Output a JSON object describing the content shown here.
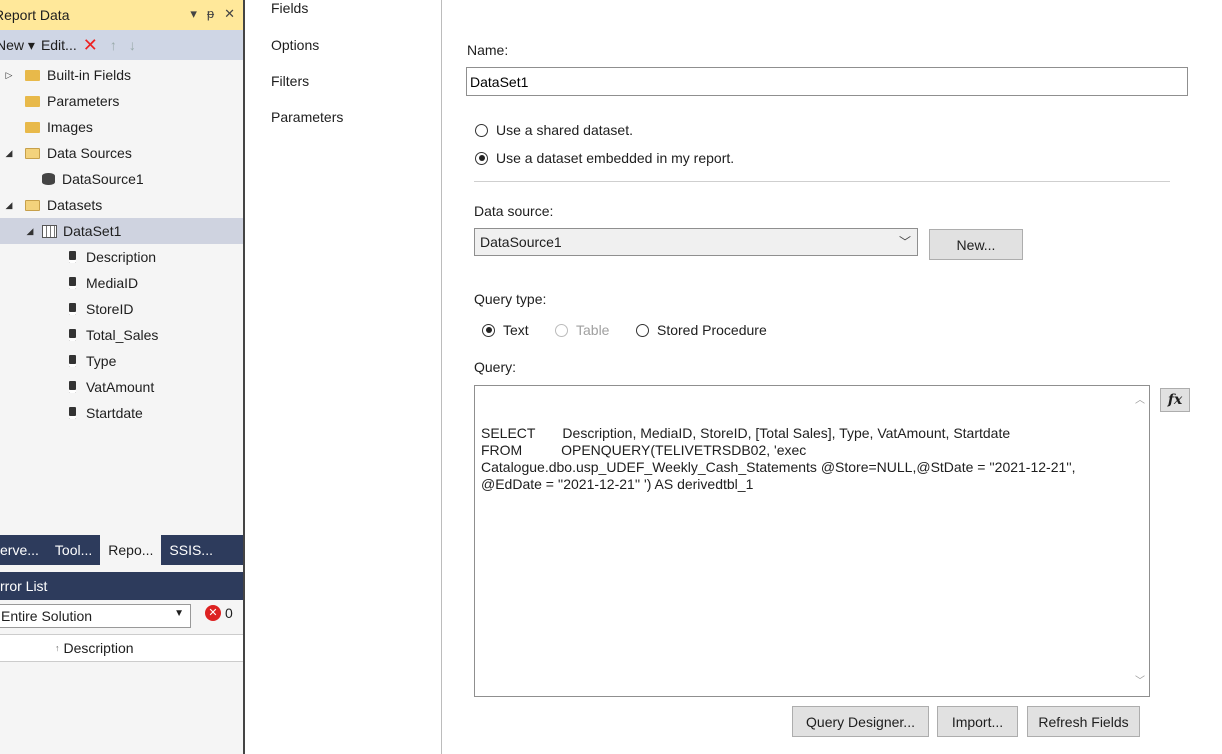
{
  "report_data": {
    "title": "Report Data",
    "title_icons": [
      "▾",
      "ᵽ",
      "✕"
    ],
    "toolbar": {
      "new_label": "New ▾",
      "edit_label": "Edit...",
      "delete_icon": "✕",
      "up_icon": "↑",
      "down_icon": "↓"
    },
    "tree": [
      {
        "label": "Built-in Fields",
        "icon": "folder",
        "expander": "▷"
      },
      {
        "label": "Parameters",
        "icon": "folder"
      },
      {
        "label": "Images",
        "icon": "folder"
      },
      {
        "label": "Data Sources",
        "icon": "folder-open",
        "expander": "◢"
      },
      {
        "label": "DataSource1",
        "icon": "database"
      },
      {
        "label": "Datasets",
        "icon": "folder-open",
        "expander": "◢"
      },
      {
        "label": "DataSet1",
        "icon": "table",
        "expander": "◢",
        "selected": true
      },
      {
        "label": "Description",
        "icon": "field"
      },
      {
        "label": "MediaID",
        "icon": "field"
      },
      {
        "label": "StoreID",
        "icon": "field"
      },
      {
        "label": "Total_Sales",
        "icon": "field"
      },
      {
        "label": "Type",
        "icon": "field"
      },
      {
        "label": "VatAmount",
        "icon": "field"
      },
      {
        "label": "Startdate",
        "icon": "field"
      }
    ],
    "bottom_tabs": [
      "erve...",
      "Tool...",
      "Repo...",
      "SSIS..."
    ],
    "active_tab": "Repo..."
  },
  "error_list": {
    "title": "rror List",
    "scope": "Entire Solution",
    "error_count": "0",
    "column_description": "Description"
  },
  "nav": {
    "items": [
      "Fields",
      "Options",
      "Filters",
      "Parameters"
    ]
  },
  "form": {
    "name_label": "Name:",
    "name_value": "DataSet1",
    "shared_option": "Use a shared dataset.",
    "embedded_option": "Use a dataset embedded in my report.",
    "data_source_label": "Data source:",
    "data_source_value": "DataSource1",
    "new_button": "New...",
    "query_type_label": "Query type:",
    "query_types": [
      "Text",
      "Table",
      "Stored Procedure"
    ],
    "query_label": "Query:",
    "query_text": "SELECT       Description, MediaID, StoreID, [Total Sales], Type, VatAmount, Startdate\nFROM          OPENQUERY(TELIVETRSDB02, 'exec\nCatalogue.dbo.usp_UDEF_Weekly_Cash_Statements @Store=NULL,@StDate = ''2021-12-21'',\n@EdDate = ''2021-12-21'' ') AS derivedtbl_1",
    "fx_label": "fx",
    "query_designer_button": "Query Designer...",
    "import_button": "Import...",
    "refresh_button": "Refresh Fields"
  }
}
